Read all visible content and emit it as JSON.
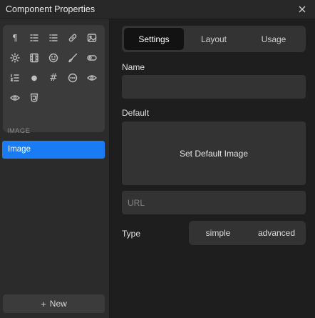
{
  "window": {
    "title": "Component Properties"
  },
  "toolbox": {
    "icons": [
      {
        "name": "paragraph-icon",
        "glyph": "¶"
      },
      {
        "name": "heading-list-icon",
        "glyph": "≡"
      },
      {
        "name": "bullet-list-icon",
        "glyph": "☰"
      },
      {
        "name": "link-icon",
        "glyph": ""
      },
      {
        "name": "image-icon",
        "glyph": ""
      },
      {
        "name": "sun-icon",
        "glyph": "☼"
      },
      {
        "name": "film-icon",
        "glyph": ""
      },
      {
        "name": "smiley-icon",
        "glyph": "☺"
      },
      {
        "name": "brush-icon",
        "glyph": ""
      },
      {
        "name": "toggle-icon",
        "glyph": ""
      },
      {
        "name": "numbered-list-icon",
        "glyph": "≡"
      },
      {
        "name": "dot-icon",
        "glyph": "●"
      },
      {
        "name": "hash-icon",
        "glyph": "#"
      },
      {
        "name": "ellipsis-circle-icon",
        "glyph": ""
      },
      {
        "name": "eye-icon",
        "glyph": ""
      },
      {
        "name": "eye-outline-icon",
        "glyph": ""
      },
      {
        "name": "css-icon",
        "glyph": ""
      }
    ]
  },
  "sidebar": {
    "section_label": "IMAGE",
    "selected_item": "Image",
    "new_button": "New"
  },
  "tabs": {
    "items": [
      "Settings",
      "Layout",
      "Usage"
    ],
    "active": "Settings"
  },
  "form": {
    "name_label": "Name",
    "name_value": "",
    "default_label": "Default",
    "set_default_image": "Set Default Image",
    "url_placeholder": "URL",
    "type_label": "Type",
    "type_options": [
      "simple",
      "advanced"
    ]
  }
}
